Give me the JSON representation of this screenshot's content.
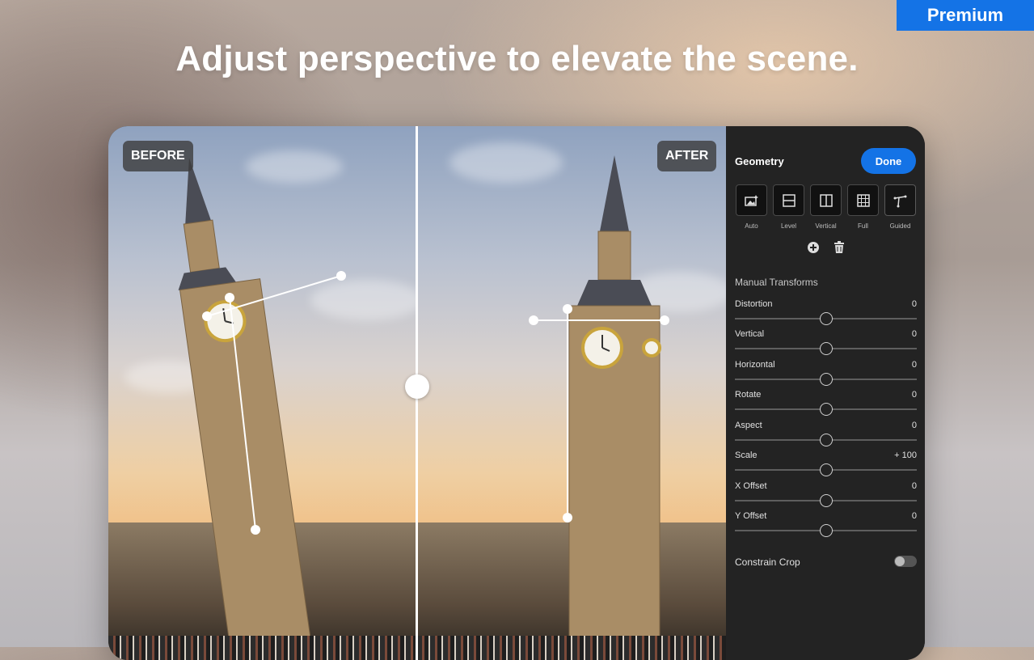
{
  "badge": {
    "label": "Premium"
  },
  "headline": "Adjust perspective to elevate the scene.",
  "comparison": {
    "before_label": "BEFORE",
    "after_label": "AFTER"
  },
  "panel": {
    "title": "Geometry",
    "done_label": "Done",
    "modes": [
      {
        "label": "Auto",
        "icon": "auto-upright-icon"
      },
      {
        "label": "Level",
        "icon": "level-icon"
      },
      {
        "label": "Vertical",
        "icon": "vertical-icon"
      },
      {
        "label": "Full",
        "icon": "full-grid-icon"
      },
      {
        "label": "Guided",
        "icon": "guided-icon"
      }
    ],
    "tools": [
      {
        "icon": "add-guide-icon"
      },
      {
        "icon": "trash-icon"
      }
    ],
    "manual_title": "Manual Transforms",
    "sliders": [
      {
        "label": "Distortion",
        "value": "0",
        "level": 0.5
      },
      {
        "label": "Vertical",
        "value": "0",
        "level": 0.5
      },
      {
        "label": "Horizontal",
        "value": "0",
        "level": 0.5
      },
      {
        "label": "Rotate",
        "value": "0",
        "level": 0.5
      },
      {
        "label": "Aspect",
        "value": "0",
        "level": 0.5
      },
      {
        "label": "Scale",
        "value": "+ 100",
        "level": 0.5
      },
      {
        "label": "X Offset",
        "value": "0",
        "level": 0.5
      },
      {
        "label": "Y Offset",
        "value": "0",
        "level": 0.5
      }
    ],
    "constrain_crop": {
      "label": "Constrain Crop",
      "on": false
    }
  },
  "colors": {
    "accent": "#1473e6",
    "panel_bg": "#232323"
  }
}
